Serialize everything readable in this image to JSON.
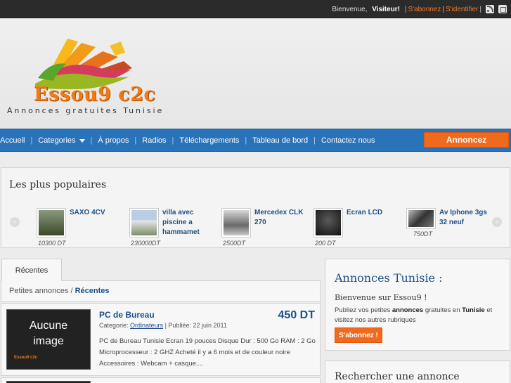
{
  "topbar": {
    "greeting": "Bienvenue,",
    "visitor": "Visiteur!",
    "subscribe_link": "S'abonnez",
    "login_link": "S'identifier",
    "sep": "|",
    "icons": [
      "rss-icon",
      "share-icon"
    ]
  },
  "header": {
    "logo_text": "Essou9  c2c",
    "tagline": "Annonces gratuites Tunisie"
  },
  "nav": {
    "items": [
      "Accueil",
      "Categories",
      "À propos",
      "Radios",
      "Téléchargements",
      "Tableau de bord",
      "Contactez nous"
    ],
    "separator": "|",
    "cta": "Annoncez"
  },
  "popular": {
    "title": "Les plus populaires",
    "items": [
      {
        "title": "SAXO 4CV",
        "price": "10300 DT",
        "color": "#4a5a3a"
      },
      {
        "title": "villa avec piscine a hammamet",
        "price": "230000DT",
        "color": "#8aa2c0"
      },
      {
        "title": "Mercedex CLK 270",
        "price": "2500DT",
        "color": "#9a9a9a"
      },
      {
        "title": "Ecran LCD",
        "price": "200 DT",
        "color": "#2a2a2a"
      },
      {
        "title": "Av Iphone 3gs 32 neuf",
        "price": "750DT",
        "color": "#444444"
      }
    ]
  },
  "main": {
    "tab": "Récentes",
    "breadcrumb_root": "Petites annonces",
    "breadcrumb_sep": "/",
    "breadcrumb_current": "Récentes",
    "listing": {
      "image_placeholder_line1": "Aucune",
      "image_placeholder_line2": "image",
      "mini_logo": "Essou9 c2c",
      "title": "PC de Bureau",
      "price": "450 DT",
      "meta_prefix": "Categorie:",
      "category": "Ordinateurs",
      "meta_suffix": "| Publiée: 22 juin 2011",
      "description": "PC de Bureau Tunisie Ecran 19 pouces Disque Dur : 500 Go RAM : 2 Go Microprocesseur : 2 GHZ Acheté il y a 6 mois et de couleur noire Accessoires : Webcam + casque...."
    }
  },
  "sidebar": {
    "title": "Annonces Tunisie :",
    "welcome": "Bienvenue sur Essou9 !",
    "desc_pre": "Publiez vos petites",
    "desc_b1": "annonces",
    "desc_mid": "gratuites en",
    "desc_b2": "Tunisie",
    "desc_post": "et visitez nos autres rubriques",
    "subscribe": "S'abonnez !",
    "search_title": "Rechercher une annonce"
  },
  "colors": {
    "accent": "#f06a1e",
    "nav_blue": "#2b73b9",
    "link_blue": "#1f4f87"
  }
}
